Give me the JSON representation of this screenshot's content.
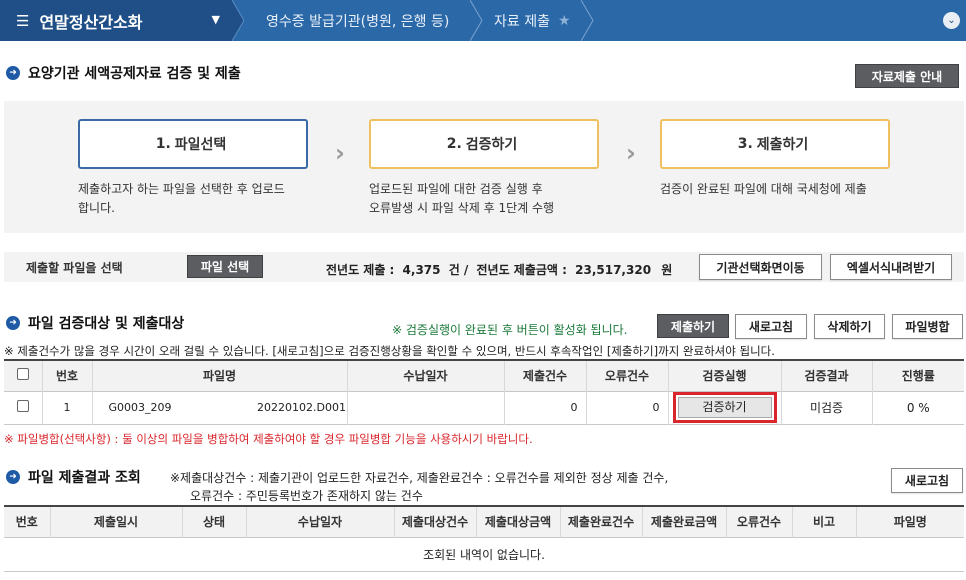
{
  "nav": {
    "menu_title": "연말정산간소화",
    "breadcrumbs": [
      "영수증 발급기관(병원, 은행 등)",
      "자료 제출"
    ]
  },
  "header": {
    "title": "요양기관 세액공제자료 검증 및 제출",
    "guide_button": "자료제출 안내"
  },
  "steps": [
    {
      "num": "1.",
      "label": "파일선택",
      "desc1": "제출하고자 하는 파일을 선택한 후 업로드",
      "desc2": "합니다."
    },
    {
      "num": "2.",
      "label": "검증하기",
      "desc1": "업로드된 파일에 대한 검증 실행 후",
      "desc2": "오류발생 시 파일 삭제 후 1단계 수행"
    },
    {
      "num": "3.",
      "label": "제출하기",
      "desc1": "검증이 완료된 파일에 대해 국세청에 제출",
      "desc2": ""
    }
  ],
  "filebar": {
    "label": "제출할 파일을 선택",
    "select_button": "파일 선택",
    "prev_year_count_label": "전년도 제출 :",
    "prev_year_count": "4,375",
    "count_unit": "건 /",
    "prev_year_amount_label": "전년도 제출금액 :",
    "prev_year_amount": "23,517,320",
    "amount_unit": "원",
    "agency_button": "기관선택화면이동",
    "excel_button": "엑셀서식내려받기"
  },
  "verify": {
    "title": "파일 검증대상 및 제출대상",
    "hint": "※ 검증실행이 완료된 후 버튼이 활성화 됩니다.",
    "buttons": {
      "submit": "제출하기",
      "refresh": "새로고침",
      "delete": "삭제하기",
      "merge": "파일병합"
    },
    "notice": "※ 제출건수가 많을 경우 시간이 오래 걸릴 수 있습니다. [새로고침]으로 검증진행상황을 확인할 수 있으며, 반드시 후속작업인 [제출하기]까지 완료하셔야 됩니다.",
    "columns": [
      "번호",
      "파일명",
      "수납일자",
      "제출건수",
      "오류건수",
      "검증실행",
      "검증결과",
      "진행률"
    ],
    "rows": [
      {
        "no": "1",
        "file_prefix": "G0003_209",
        "file_name": "20220102.D001",
        "pay_date": "",
        "submit_count": "0",
        "error_count": "0",
        "run_label": "검증하기",
        "result": "미검증",
        "progress": "0 %"
      }
    ],
    "merge_notice": "※ 파일병합(선택사항) : 둘 이상의 파일을 병합하여 제출하여야 할 경우 파일병합 기능을 사용하시기 바랍니다."
  },
  "results": {
    "title": "파일 제출결과 조회",
    "note1": "※제출대상건수 : 제출기관이 업로드한 자료건수, 제출완료건수 : 오류건수를 제외한 정상 제출 건수,",
    "note2": "오류건수 : 주민등록번호가 존재하지 않는 건수",
    "refresh_button": "새로고침",
    "columns": [
      "번호",
      "제출일시",
      "상태",
      "수납일자",
      "제출대상건수",
      "제출대상금액",
      "제출완료건수",
      "제출완료금액",
      "오류건수",
      "비고",
      "파일명"
    ],
    "empty": "조회된 내역이 없습니다."
  },
  "colors": {
    "nav": "#2b68a8",
    "nav_dark": "#1f4f86",
    "accent_red": "#d9262c",
    "hint_green": "#1a7a3a"
  }
}
